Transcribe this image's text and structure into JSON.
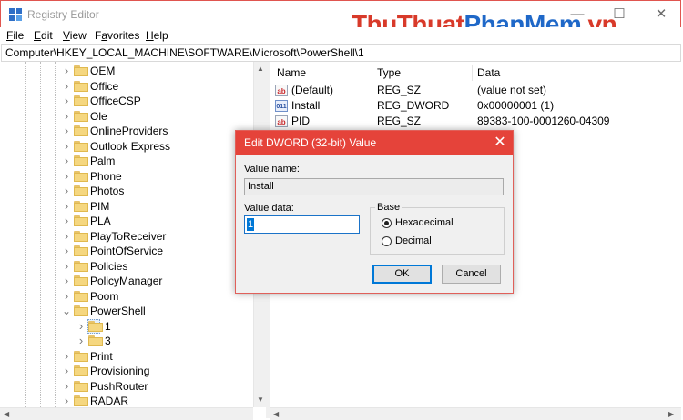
{
  "window": {
    "title": "Registry Editor",
    "minimize": "—",
    "maximize": "☐",
    "close": "✕"
  },
  "watermark": {
    "part1": "ThuThuat",
    "part2": "PhanMem",
    "part3": ".vn"
  },
  "menu": [
    {
      "label": "File",
      "key": "F",
      "rest": "ile"
    },
    {
      "label": "Edit",
      "key": "E",
      "rest": "dit"
    },
    {
      "label": "View",
      "key": "V",
      "rest": "iew"
    },
    {
      "label": "Favorites",
      "key": "a",
      "pre": "F",
      "rest": "vorites"
    },
    {
      "label": "Help",
      "key": "H",
      "rest": "elp"
    }
  ],
  "address": "Computer\\HKEY_LOCAL_MACHINE\\SOFTWARE\\Microsoft\\PowerShell\\1",
  "tree": [
    {
      "label": "OEM",
      "expandable": true
    },
    {
      "label": "Office",
      "expandable": true
    },
    {
      "label": "OfficeCSP",
      "expandable": true
    },
    {
      "label": "Ole",
      "expandable": true
    },
    {
      "label": "OnlineProviders",
      "expandable": true
    },
    {
      "label": "Outlook Express",
      "expandable": true
    },
    {
      "label": "Palm",
      "expandable": true
    },
    {
      "label": "Phone",
      "expandable": true
    },
    {
      "label": "Photos",
      "expandable": true
    },
    {
      "label": "PIM",
      "expandable": true
    },
    {
      "label": "PLA",
      "expandable": true
    },
    {
      "label": "PlayToReceiver",
      "expandable": true
    },
    {
      "label": "PointOfService",
      "expandable": true
    },
    {
      "label": "Policies",
      "expandable": true
    },
    {
      "label": "PolicyManager",
      "expandable": true
    },
    {
      "label": "Poom",
      "expandable": true
    },
    {
      "label": "PowerShell",
      "expanded": true
    },
    {
      "label": "1",
      "child": true,
      "selected": true
    },
    {
      "label": "3",
      "child": true
    },
    {
      "label": "Print",
      "expandable": true
    },
    {
      "label": "Provisioning",
      "expandable": true
    },
    {
      "label": "PushRouter",
      "expandable": true
    },
    {
      "label": "RADAR",
      "expandable": true
    }
  ],
  "list": {
    "headers": [
      "Name",
      "Type",
      "Data"
    ],
    "rows": [
      {
        "name": "(Default)",
        "type": "REG_SZ",
        "data": "(value not set)",
        "icon": "string-value-icon"
      },
      {
        "name": "Install",
        "type": "REG_DWORD",
        "data": "0x00000001 (1)",
        "icon": "binary-value-icon"
      },
      {
        "name": "PID",
        "type": "REG_SZ",
        "data": "89383-100-0001260-04309",
        "icon": "string-value-icon"
      }
    ]
  },
  "dialog": {
    "title": "Edit DWORD (32-bit) Value",
    "close": "✕",
    "value_name_label": "Value name:",
    "value_name": "Install",
    "value_data_label": "Value data:",
    "value_data": "1",
    "base_label": "Base",
    "base_options": [
      "Hexadecimal",
      "Decimal"
    ],
    "base_selected": "Hexadecimal",
    "ok": "OK",
    "cancel": "Cancel"
  },
  "colors": {
    "accent": "#e5433a",
    "selection": "#0078d7"
  }
}
